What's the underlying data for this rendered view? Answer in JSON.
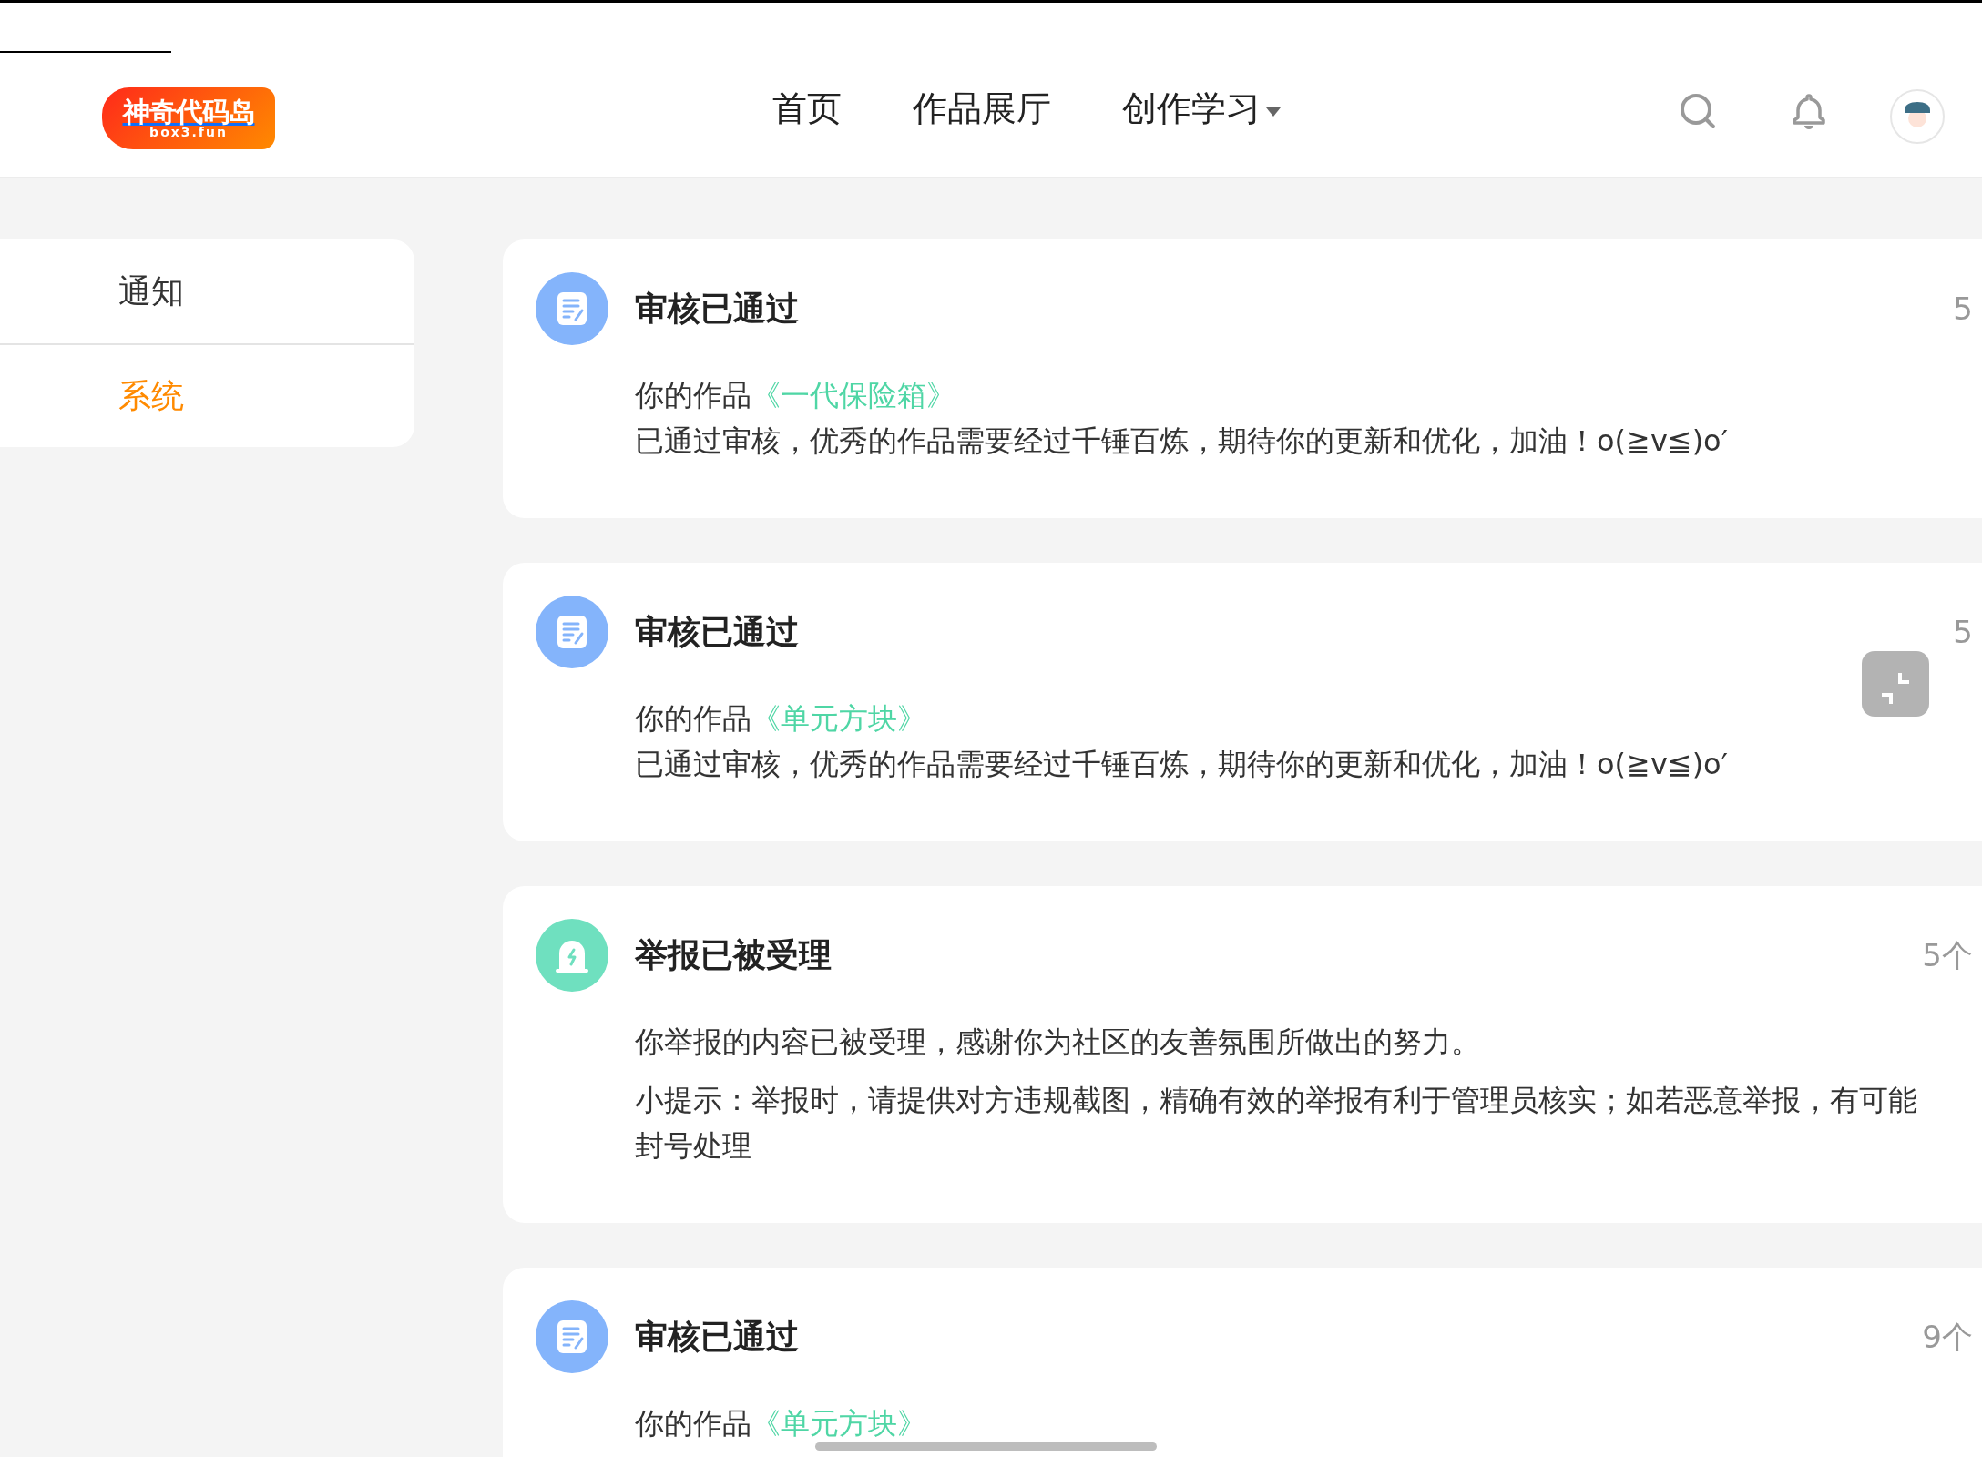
{
  "header": {
    "logo": {
      "title": "神奇代码岛",
      "subtitle": "box3.fun"
    },
    "nav": [
      {
        "label": "首页",
        "dropdown": false
      },
      {
        "label": "作品展厅",
        "dropdown": false
      },
      {
        "label": "创作学习",
        "dropdown": true
      }
    ]
  },
  "sidebar": {
    "items": [
      {
        "label": "通知",
        "selected": false
      },
      {
        "label": "系统",
        "selected": true
      }
    ]
  },
  "notifications": [
    {
      "kind": "review",
      "title": "审核已通过",
      "time": "5",
      "prefix": "你的作品",
      "work": "《一代保险箱》",
      "message": "已通过审核，优秀的作品需要经过千锤百炼，期待你的更新和优化，加油！o(≧v≦)o′"
    },
    {
      "kind": "review",
      "title": "审核已通过",
      "time": "5",
      "prefix": "你的作品",
      "work": "《单元方块》",
      "message": "已通过审核，优秀的作品需要经过千锤百炼，期待你的更新和优化，加油！o(≧v≦)o′"
    },
    {
      "kind": "report",
      "title": "举报已被受理",
      "time": "5个",
      "paragraphs": [
        {
          "lines": [
            "你举报的内容已被受理，感谢你为社区的友善氛围所做出的努力。"
          ]
        },
        {
          "lines": [
            "小提示：举报时，请提供对方违规截图，精确有效的举报有利于管理员核实；如若恶意举报，有可能",
            "封号处理"
          ]
        }
      ]
    },
    {
      "kind": "review",
      "title": "审核已通过",
      "time": "9个",
      "prefix": "你的作品",
      "work": "《单元方块》"
    }
  ]
}
